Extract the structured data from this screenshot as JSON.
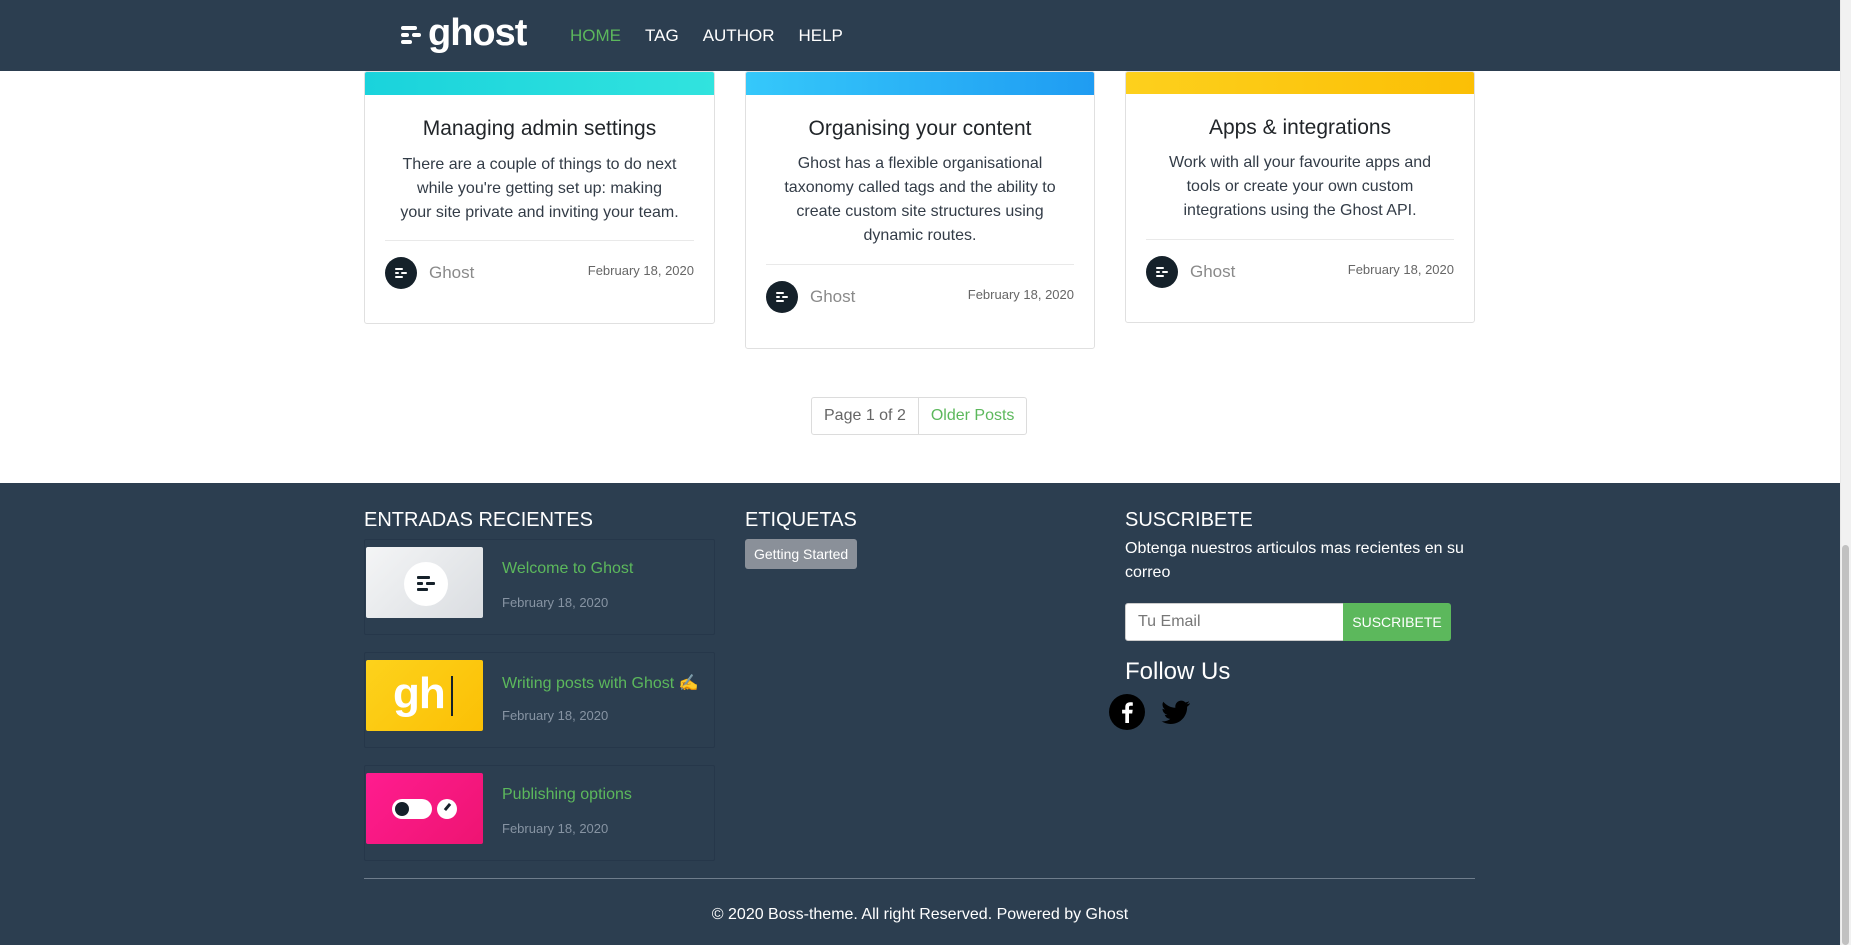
{
  "nav": {
    "logo_text": "ghost",
    "items": [
      {
        "label": "HOME",
        "active": true
      },
      {
        "label": "TAG",
        "active": false
      },
      {
        "label": "AUTHOR",
        "active": false
      },
      {
        "label": "HELP",
        "active": false
      }
    ]
  },
  "cards": [
    {
      "title": "Managing admin settings",
      "text": "There are a couple of things to do next while you're getting set up: making your site private and inviting your team.",
      "author": "Ghost",
      "date": "February 18, 2020",
      "bar_color": "#1ad3dc"
    },
    {
      "title": "Organising your content",
      "text": "Ghost has a flexible organisational taxonomy called tags and the ability to create custom site structures using dynamic routes.",
      "author": "Ghost",
      "date": "February 18, 2020",
      "bar_color": "#2aaaf4"
    },
    {
      "title": "Apps & integrations",
      "text": "Work with all your favourite apps and tools or create your own custom integrations using the Ghost API.",
      "author": "Ghost",
      "date": "February 18, 2020",
      "bar_color": "#fdc90f"
    }
  ],
  "pagination": {
    "info": "Page 1 of 2",
    "older": "Older Posts"
  },
  "footer": {
    "recent_heading": "ENTRADAS RECIENTES",
    "recent_posts": [
      {
        "title": "Welcome to Ghost",
        "date": "February 18, 2020",
        "thumb": "ghost-logo"
      },
      {
        "title": "Writing posts with Ghost ✍️",
        "date": "February 18, 2020",
        "thumb": "gh"
      },
      {
        "title": "Publishing options",
        "date": "February 18, 2020",
        "thumb": "toggle"
      }
    ],
    "thumb_gh_text": "gh",
    "tags_heading": "ETIQUETAS",
    "tags": [
      "Getting Started"
    ],
    "subscribe_heading": "SUSCRIBETE",
    "subscribe_text": "Obtenga nuestros articulos mas recientes en su correo",
    "email_placeholder": "Tu Email",
    "subscribe_button": "SUSCRIBETE",
    "follow_heading": "Follow Us",
    "social_icons": [
      "facebook-icon",
      "twitter-icon"
    ],
    "copyright": "© 2020 Boss-theme. All right Reserved. Powered by Ghost"
  },
  "colors": {
    "navbar_bg": "#2c3e50",
    "accent": "#5cb85c",
    "footer_bg": "#2c3e50"
  }
}
